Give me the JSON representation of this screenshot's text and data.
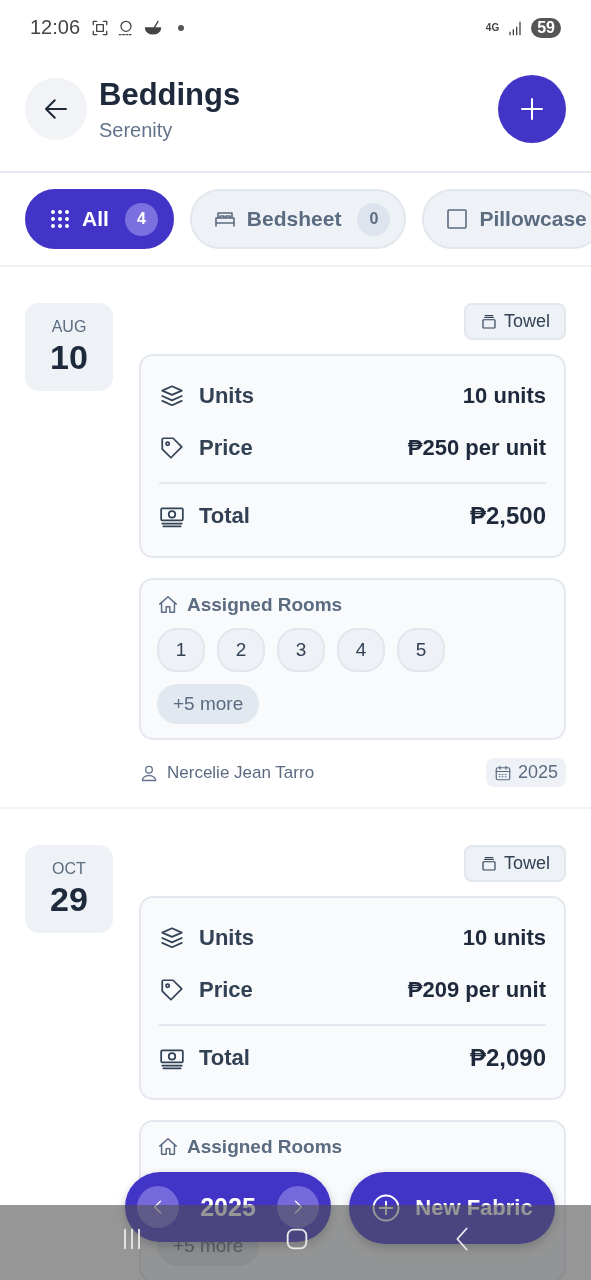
{
  "status_bar": {
    "time": "12:06",
    "network": "4G",
    "battery": "59"
  },
  "header": {
    "title": "Beddings",
    "subtitle": "Serenity"
  },
  "filters": [
    {
      "kind": "all",
      "label": "All",
      "count": "4",
      "selected": true
    },
    {
      "kind": "bed",
      "label": "Bedsheet",
      "count": "0",
      "selected": false
    },
    {
      "kind": "square",
      "label": "Pillowcase",
      "selected": false
    }
  ],
  "entries": [
    {
      "month": "AUG",
      "day": "10",
      "type": "Towel",
      "rows": [
        {
          "kind": "units",
          "label": "Units",
          "value": "10 units"
        },
        {
          "kind": "price",
          "label": "Price",
          "value": "₱250 per unit"
        },
        {
          "kind": "total",
          "label": "Total",
          "value": "₱2,500"
        }
      ],
      "rooms_title": "Assigned Rooms",
      "rooms": [
        {
          "label": "1"
        },
        {
          "label": "2"
        },
        {
          "label": "3"
        },
        {
          "label": "4"
        },
        {
          "label": "5"
        }
      ],
      "more": "+5 more",
      "person": "Nercelie Jean Tarro",
      "year": "2025"
    },
    {
      "month": "OCT",
      "day": "29",
      "type": "Towel",
      "rows": [
        {
          "kind": "units",
          "label": "Units",
          "value": "10 units"
        },
        {
          "kind": "price",
          "label": "Price",
          "value": "₱209 per unit"
        },
        {
          "kind": "total",
          "label": "Total",
          "value": "₱2,090"
        }
      ],
      "rooms_title": "Assigned Rooms",
      "more": "+5 more"
    }
  ],
  "year_switcher": {
    "year": "2025"
  },
  "new_button": {
    "label": "New Fabric"
  }
}
